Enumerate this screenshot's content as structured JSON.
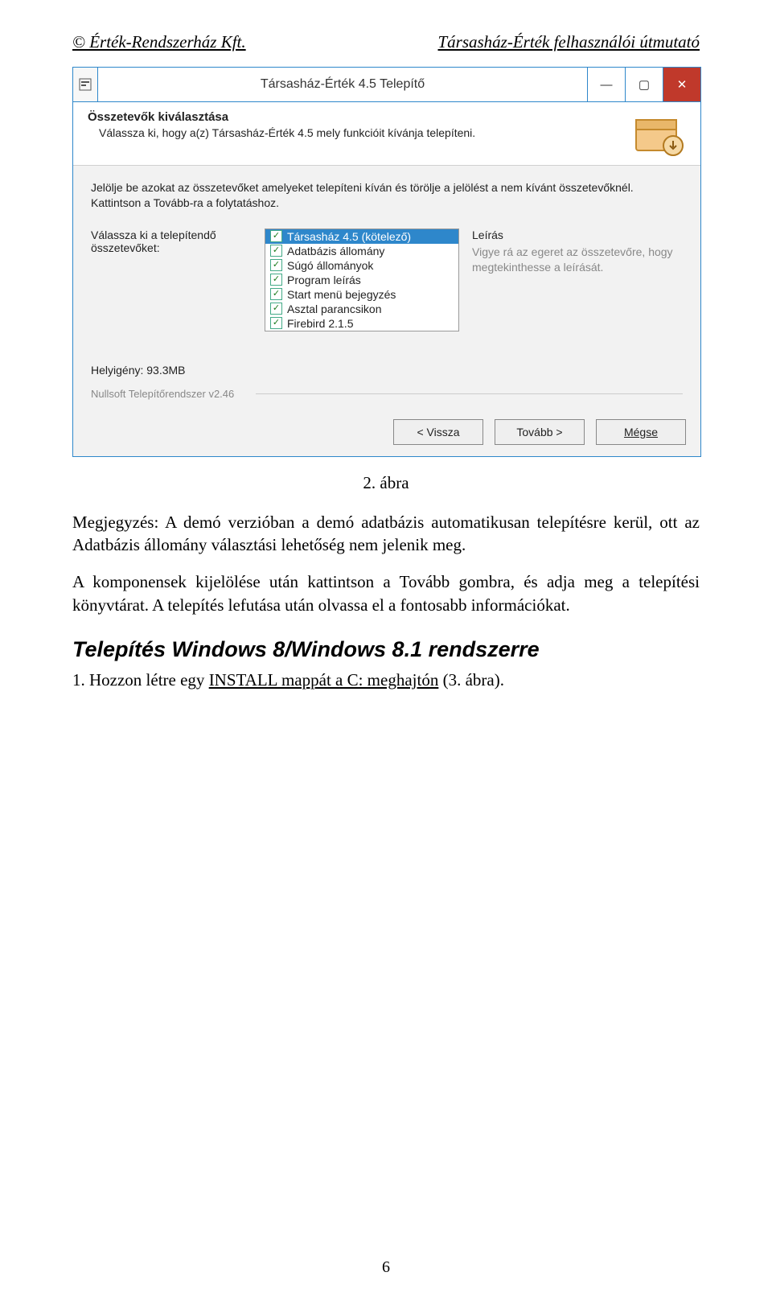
{
  "header": {
    "left": "© Érték-Rendszerház Kft.",
    "right": "Társasház-Érték felhasználói útmutató"
  },
  "installer": {
    "title": "Társasház-Érték 4.5 Telepítő",
    "subhead": "Összetevők kiválasztása",
    "subdesc": "Válassza ki, hogy a(z) Társasház-Érték 4.5 mely funkcióit kívánja telepíteni.",
    "instruction": "Jelölje be azokat az összetevőket amelyeket telepíteni kíván és törölje a jelölést a nem kívánt összetevőknél. Kattintson a Tovább-ra a folytatáshoz.",
    "select_label": "Válassza ki a telepítendő összetevőket:",
    "components": [
      "Társasház 4.5 (kötelező)",
      "Adatbázis állomány",
      "Súgó állományok",
      "Program leírás",
      "Start menü bejegyzés",
      "Asztal parancsikon",
      "Firebird 2.1.5"
    ],
    "desc_head": "Leírás",
    "desc_text": "Vigye rá az egeret az összetevőre, hogy megtekinthesse a leírását.",
    "space_req": "Helyigény: 93.3MB",
    "sys_line": "Nullsoft Telepítőrendszer v2.46",
    "btn_back": "< Vissza",
    "btn_next": "Tovább >",
    "btn_cancel": "Mégse"
  },
  "text": {
    "caption": "2. ábra",
    "p1": "Megjegyzés: A demó verzióban a demó adatbázis automatikusan telepítésre kerül, ott az Adatbázis állomány választási lehetőség nem jelenik meg.",
    "p2": "A komponensek kijelölése után kattintson a Tovább gombra, és adja meg a telepítési könyvtárat. A telepítés lefutása után olvassa el a fontosabb információkat.",
    "section": "Telepítés Windows 8/Windows 8.1 rendszerre",
    "step1_prefix": "1. Hozzon létre egy ",
    "step1_link": "INSTALL mappát a C: meghajtón",
    "step1_suffix": " (3. ábra).",
    "pagenum": "6"
  }
}
